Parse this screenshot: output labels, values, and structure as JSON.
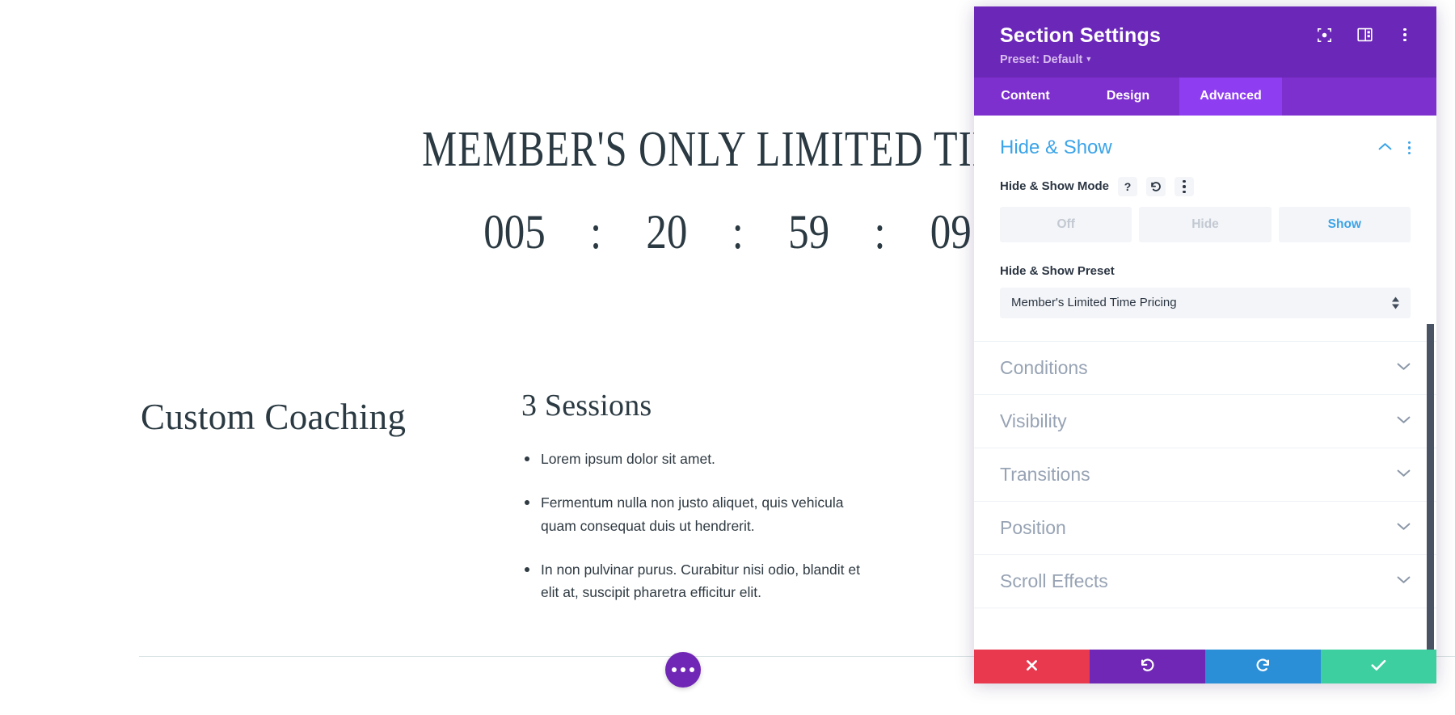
{
  "page": {
    "heading": "MEMBER'S ONLY LIMITED TIME",
    "countdown": {
      "days": "005",
      "hours": "20",
      "minutes": "59",
      "seconds": "09",
      "separator": ":"
    },
    "left_column": {
      "title": "Custom Coaching"
    },
    "middle_column": {
      "title": "3 Sessions",
      "bullets": [
        "Lorem ipsum dolor sit amet.",
        "Fermentum nulla non justo aliquet, quis vehicula quam consequat duis ut hendrerit.",
        "In non pulvinar purus. Curabitur nisi odio, blandit et elit at, suscipit pharetra efficitur elit."
      ]
    },
    "fab": {
      "icon": "ellipsis-horizontal-icon"
    },
    "colors": {
      "text": "#2b3a42",
      "accent": "#7027b5"
    }
  },
  "panel": {
    "title": "Section Settings",
    "preset_label": "Preset: Default",
    "header_icons": [
      {
        "name": "focus-target-icon"
      },
      {
        "name": "layout-panel-icon"
      },
      {
        "name": "overflow-menu-icon"
      }
    ],
    "tabs": [
      {
        "label": "Content",
        "active": false
      },
      {
        "label": "Design",
        "active": false
      },
      {
        "label": "Advanced",
        "active": true
      }
    ],
    "open_section": {
      "title": "Hide & Show",
      "collapse_icon": "chevron-up-icon",
      "menu_icon": "overflow-menu-icon",
      "mode": {
        "label": "Hide & Show Mode",
        "help_icon": "question-mark-icon",
        "reset_icon": "reset-arrow-icon",
        "menu_icon": "overflow-menu-icon",
        "options": [
          {
            "label": "Off",
            "active": false
          },
          {
            "label": "Hide",
            "active": false
          },
          {
            "label": "Show",
            "active": true
          }
        ]
      },
      "preset": {
        "label": "Hide & Show Preset",
        "value": "Member's Limited Time Pricing",
        "stepper_icon": "up-down-arrows-icon"
      }
    },
    "accordion_sections": [
      {
        "label": "Conditions",
        "icon": "chevron-down-icon"
      },
      {
        "label": "Visibility",
        "icon": "chevron-down-icon"
      },
      {
        "label": "Transitions",
        "icon": "chevron-down-icon"
      },
      {
        "label": "Position",
        "icon": "chevron-down-icon"
      },
      {
        "label": "Scroll Effects",
        "icon": "chevron-down-icon"
      }
    ],
    "footer_buttons": [
      {
        "name": "cancel-button",
        "icon": "close-x-icon",
        "color": "#e8394f"
      },
      {
        "name": "undo-button",
        "icon": "undo-arrow-icon",
        "color": "#7027b5"
      },
      {
        "name": "redo-button",
        "icon": "redo-arrow-icon",
        "color": "#2b8fd8"
      },
      {
        "name": "save-button",
        "icon": "checkmark-icon",
        "color": "#3ecfa0"
      }
    ],
    "colors": {
      "header_purple": "#6b28b8",
      "tabs_purple": "#7e30cf",
      "active_tab_purple": "#8f3df0",
      "link_blue": "#3ba4e8"
    }
  }
}
